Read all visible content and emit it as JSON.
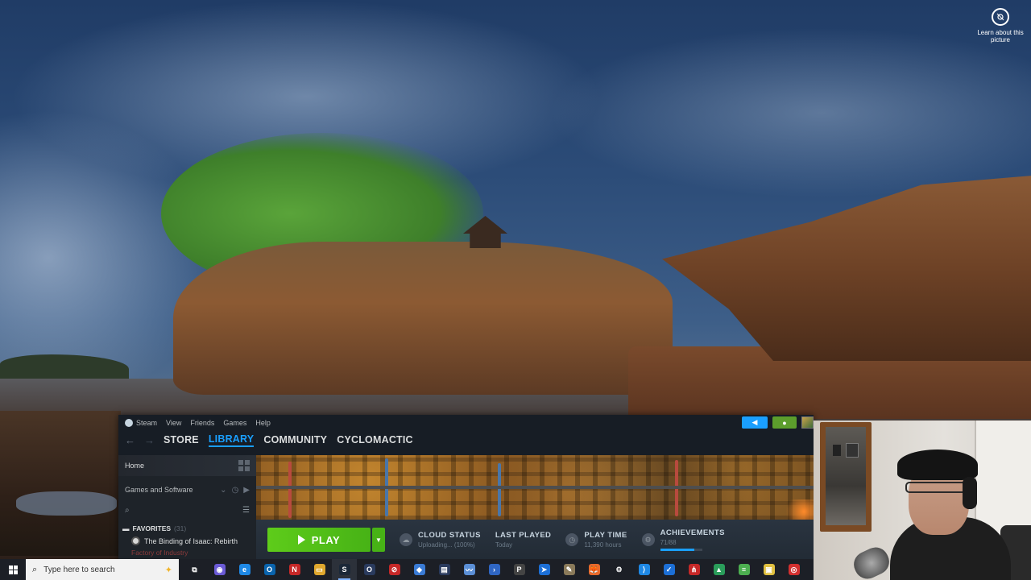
{
  "desktop": {
    "learn_picture": "Learn about this picture"
  },
  "steam": {
    "menu": [
      "Steam",
      "View",
      "Friends",
      "Games",
      "Help"
    ],
    "tabs": [
      "STORE",
      "LIBRARY",
      "COMMUNITY",
      "CYCLOMACTIC"
    ],
    "active_tab": "LIBRARY",
    "sidebar": {
      "home": "Home",
      "filter": "Games and Software",
      "favorites_label": "FAVORITES",
      "favorites_count": "(31)",
      "games": [
        "The Binding of Isaac: Rebirth",
        "Factory of Industry"
      ]
    },
    "gamebar": {
      "play": "PLAY",
      "stats": [
        {
          "label": "CLOUD STATUS",
          "sub": "Uploading... (100%)",
          "icon": "cloud-icon"
        },
        {
          "label": "LAST PLAYED",
          "sub": "Today",
          "icon": ""
        },
        {
          "label": "PLAY TIME",
          "sub": "11,390 hours",
          "icon": "clock-icon"
        },
        {
          "label": "ACHIEVEMENTS",
          "sub": "71/88",
          "icon": "trophy-icon",
          "progress": 0.81
        }
      ]
    }
  },
  "taskbar": {
    "search_placeholder": "Type here to search",
    "apps": [
      {
        "name": "task-view-icon",
        "glyph": "⧉",
        "color": "#1c1f26"
      },
      {
        "name": "obs-icon",
        "glyph": "◉",
        "color": "#6b5bd6"
      },
      {
        "name": "edge-icon",
        "glyph": "e",
        "color": "#1e88e5"
      },
      {
        "name": "outlook-icon",
        "glyph": "O",
        "color": "#0a64ad"
      },
      {
        "name": "news-icon",
        "glyph": "N",
        "color": "#c62828"
      },
      {
        "name": "file-explorer-icon",
        "glyph": "▭",
        "color": "#e0a82e"
      },
      {
        "name": "steam-icon",
        "glyph": "S",
        "color": "#1b2838"
      },
      {
        "name": "app-o-icon",
        "glyph": "O",
        "color": "#2a3b5e"
      },
      {
        "name": "antivirus-icon",
        "glyph": "⊘",
        "color": "#c62828"
      },
      {
        "name": "vpn-icon",
        "glyph": "◆",
        "color": "#3a7bd5"
      },
      {
        "name": "terminal-icon",
        "glyph": "▤",
        "color": "#2a3b5e"
      },
      {
        "name": "wave-icon",
        "glyph": "〰",
        "color": "#5b8fd6"
      },
      {
        "name": "powershell-icon",
        "glyph": "›",
        "color": "#2f66c3"
      },
      {
        "name": "prompt-icon",
        "glyph": "P",
        "color": "#444"
      },
      {
        "name": "app-arrow-icon",
        "glyph": "➤",
        "color": "#1c6fd6"
      },
      {
        "name": "paint-icon",
        "glyph": "✎",
        "color": "#8a7a5a"
      },
      {
        "name": "firefox-icon",
        "glyph": "🦊",
        "color": "#e8692a"
      },
      {
        "name": "settings-icon",
        "glyph": "⚙",
        "color": "#1c1f26"
      },
      {
        "name": "vscode-icon",
        "glyph": "⟩",
        "color": "#1e88e5"
      },
      {
        "name": "check-icon",
        "glyph": "✓",
        "color": "#1c6fd6"
      },
      {
        "name": "git-icon",
        "glyph": "⋔",
        "color": "#c62828"
      },
      {
        "name": "drive-icon",
        "glyph": "▲",
        "color": "#2a9d5a"
      },
      {
        "name": "notepad-icon",
        "glyph": "≡",
        "color": "#4caf50"
      },
      {
        "name": "package-icon",
        "glyph": "▣",
        "color": "#e0c040"
      },
      {
        "name": "chrome-icon",
        "glyph": "◎",
        "color": "#d32f2f"
      }
    ]
  },
  "colors": {
    "steam_bg": "#171d25",
    "accent": "#1a9fff",
    "play_green": "#5ecc1a"
  }
}
